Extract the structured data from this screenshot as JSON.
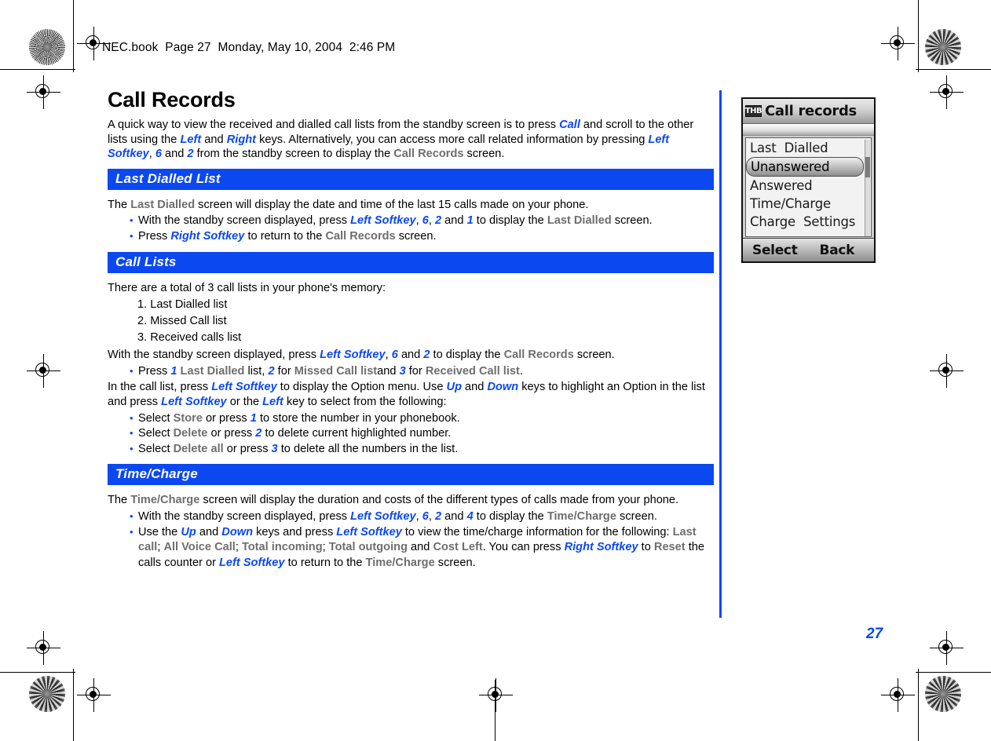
{
  "header": {
    "text": "NEC.book  Page 27  Monday, May 10, 2004  2:46 PM"
  },
  "page_number": "27",
  "colors": {
    "accent_blue": "#0b48f0",
    "screen_name_gray": "#6e6e6e"
  },
  "content": {
    "title": "Call Records",
    "intro": {
      "part1": "A quick way to view the received and dialled call lists from the standby screen is to press ",
      "key_call": "Call",
      "part2": " and scroll to the other lists using the ",
      "key_left": "Left",
      "part3": " and ",
      "key_right": "Right",
      "part4": " keys. Alternatively, you can access more call related information by pressing ",
      "key_leftsoftkey": "Left Softkey",
      "part5": ", ",
      "key_6": "6",
      "part6": " and ",
      "key_2": "2",
      "part7": " from the standby screen to display the ",
      "screen_callrecords": "Call Records",
      "part8": " screen."
    },
    "sections": [
      {
        "heading": "Last Dialled List",
        "lead": {
          "part1": "The ",
          "screen": "Last Dialled",
          "part2": " screen will display the date and time of the last 15 calls made on your phone."
        },
        "bullets": [
          {
            "part1": "With the standby screen displayed, press ",
            "k1": "Left Softkey",
            "part2": ", ",
            "k2": "6",
            "part3": ", ",
            "k3": "2",
            "part4": " and ",
            "k4": "1",
            "part5": " to display the ",
            "s1": "Last Dialled",
            "part6": " screen."
          },
          {
            "part1": "Press ",
            "k1": "Right Softkey",
            "part2": " to return to the ",
            "s1": "Call Records",
            "part3": " screen."
          }
        ]
      },
      {
        "heading": "Call Lists",
        "lead_plain": "There are a total of 3 call lists in your phone's memory:",
        "numbered": [
          "1. Last Dialled list",
          "2. Missed Call list",
          "3. Received calls list"
        ],
        "after_list": {
          "part1": "With the standby screen displayed, press ",
          "k1": "Left Softkey",
          "part2": ", ",
          "k2": "6",
          "part3": " and ",
          "k3": "2",
          "part4": " to display the ",
          "s1": "Call Records",
          "part5": " screen."
        },
        "press_bullet": {
          "part1": "Press ",
          "k1": "1",
          "part2": " ",
          "s1": "Last Dialled",
          "part3": " list, ",
          "k2": "2",
          "part4": "  for ",
          "s2": "Missed Call list",
          "part5": "and ",
          "k3": "3",
          "part6": "  for ",
          "s3": "Received Call list",
          "part7": "."
        },
        "option_para": {
          "part1": "In the call list, press ",
          "k1": "Left Softkey",
          "part2": " to display the Option menu. Use ",
          "k2": "Up",
          "part3": " and ",
          "k3": "Down",
          "part4": " keys to highlight an Option in the list and press ",
          "k4": "Left Softkey",
          "part5": " or the ",
          "k5": "Left",
          "part6": " key to select from the following:"
        },
        "option_bullets": [
          {
            "part1": "Select ",
            "s1": "Store",
            "part2": " or press ",
            "k1": "1",
            "part3": " to store the number in your phonebook."
          },
          {
            "part1": "Select ",
            "s1": "Delete",
            "part2": " or press ",
            "k1": "2",
            "part3": " to delete current highlighted number."
          },
          {
            "part1": "Select ",
            "s1": "Delete all",
            "part2": " or press ",
            "k1": "3",
            "part3": " to delete all the numbers in the list."
          }
        ]
      },
      {
        "heading": "Time/Charge",
        "lead": {
          "part1": "The ",
          "screen": "Time/Charge",
          "part2": " screen will display the duration and costs of the different types of calls made from your phone."
        },
        "bullets": [
          {
            "part1": "With the standby screen displayed, press ",
            "k1": "Left Softkey",
            "part2": ", ",
            "k2": "6",
            "part3": ", ",
            "k3": "2",
            "part4": " and ",
            "k4": "4",
            "part5": " to display the ",
            "s1": "Time/Charge",
            "part6": " screen."
          }
        ],
        "last_bullet": {
          "part1": "Use the ",
          "k1": "Up",
          "part2": " and ",
          "k2": "Down",
          "part3": " keys and press ",
          "k3": "Left Softkey",
          "part4": " to view the time/charge information for the following:  ",
          "s1": "Last call",
          "part5": "; ",
          "s2": "All Voice Call",
          "part6": "; ",
          "s3": "Total incoming",
          "part7": "; ",
          "s4": "Total outgoing",
          "part8": " and ",
          "s5": "Cost Left",
          "part9": ". You can press ",
          "k4": "Right Softkey",
          "part10": " to ",
          "s6": "Reset",
          "part11": " the calls counter or ",
          "k5": "Left Softkey",
          "part12": " to return to the ",
          "s7": "Time/Charge",
          "part13": " screen."
        }
      }
    ]
  },
  "phone_screen": {
    "status_badge": "THB",
    "title": "Call records",
    "menu_items": [
      "Last  Dialled",
      "Unanswered",
      "Answered",
      "Time/Charge",
      "Charge  Settings"
    ],
    "selected_index": 1,
    "softkey_left": "Select",
    "softkey_right": "Back"
  }
}
